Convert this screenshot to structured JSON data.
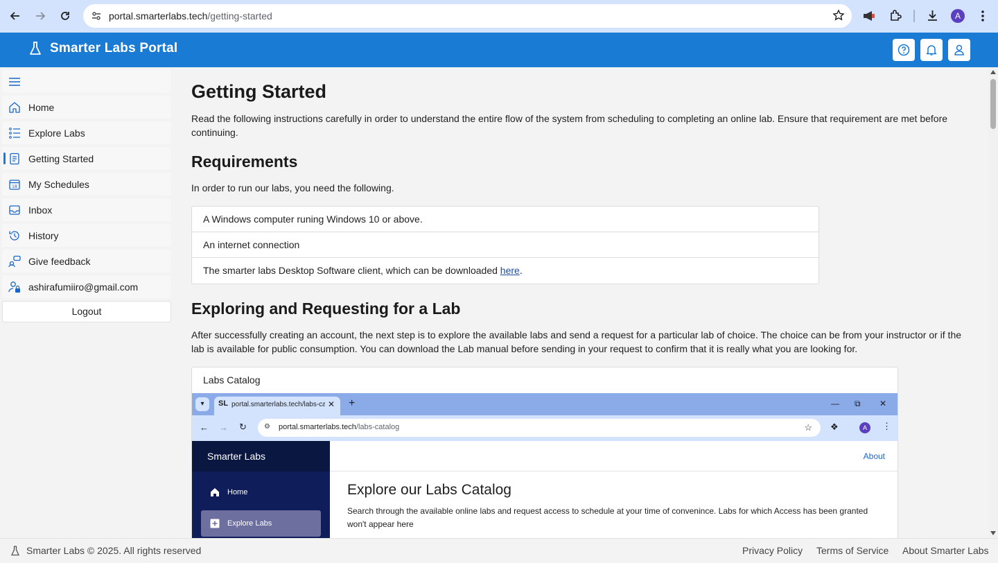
{
  "browser": {
    "url_host": "portal.smarterlabs.tech",
    "url_path": "/getting-started",
    "profile_initial": "A"
  },
  "header": {
    "title": "Smarter Labs Portal",
    "accent": "#1a7bd5"
  },
  "sidebar": {
    "items": [
      {
        "label": "Home",
        "icon": "home-icon"
      },
      {
        "label": "Explore Labs",
        "icon": "list-icon"
      },
      {
        "label": "Getting Started",
        "icon": "document-icon"
      },
      {
        "label": "My Schedules",
        "icon": "calendar-icon"
      },
      {
        "label": "Inbox",
        "icon": "inbox-icon"
      },
      {
        "label": "History",
        "icon": "history-icon"
      },
      {
        "label": "Give feedback",
        "icon": "feedback-icon"
      },
      {
        "label": "ashirafumiiro@gmail.com",
        "icon": "user-lock-icon"
      }
    ],
    "logout": "Logout"
  },
  "main": {
    "title": "Getting Started",
    "intro": "Read the following instructions carefully in order to understand the entire flow of the system from scheduling to completing an online lab. Ensure that requirement are met before continuing.",
    "requirements": {
      "heading": "Requirements",
      "lead": "In order to run our labs, you need the following.",
      "items": [
        "A Windows computer runing Windows 10 or above.",
        "An internet connection",
        "The smarter labs Desktop Software client, which can be downloaded "
      ],
      "link_text": "here",
      "link_suffix": "."
    },
    "exploring": {
      "heading": "Exploring and Requesting for a Lab",
      "body": "After successfully creating an account, the next step is to explore the available labs and send a request for a particular lab of choice. The choice can be from your instructor or if the lab is available for public consumption. You can download the Lab manual before sending in your request to confirm that it is really what you are looking for.",
      "card_title": "Labs Catalog"
    },
    "embedded": {
      "tab_icon_text": "SL",
      "tab_title": "portal.smarterlabs.tech/labs-catalog",
      "url_host": "portal.smarterlabs.tech",
      "url_path": "/labs-catalog",
      "profile_initial": "A",
      "brand": "Smarter Labs",
      "nav": [
        "Home",
        "Explore Labs"
      ],
      "about": "About",
      "heading": "Explore our Labs Catalog",
      "body": "Search through the available online labs and request access to schedule at your time of convenince. Labs for which Access has been granted won't appear here"
    }
  },
  "footer": {
    "copyright": "Smarter Labs © 2025. All rights reserved",
    "links": [
      "Privacy Policy",
      "Terms of Service",
      "About Smarter Labs"
    ]
  }
}
